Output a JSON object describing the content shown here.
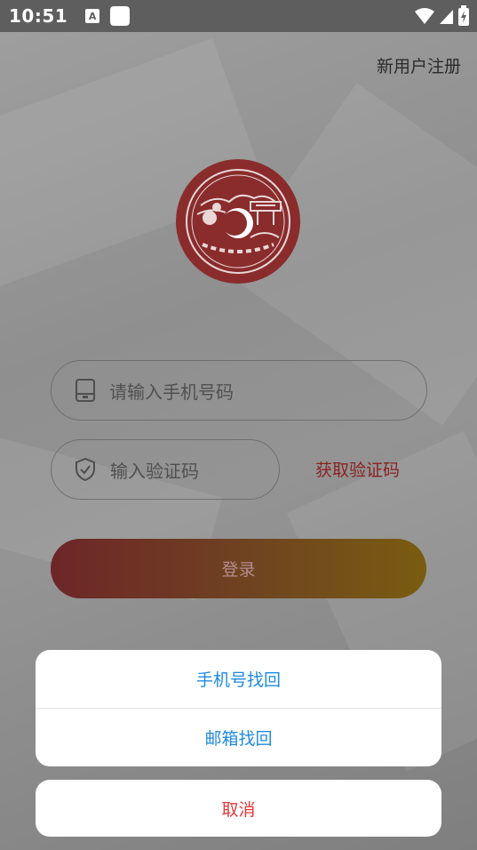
{
  "status_bar": {
    "time": "10:51",
    "notification_icon_letter": "A"
  },
  "header": {
    "register_link": "新用户注册"
  },
  "form": {
    "phone_placeholder": "请输入手机号码",
    "code_placeholder": "输入验证码",
    "get_code_label": "获取验证码",
    "login_button": "登录"
  },
  "action_sheet": {
    "items": [
      {
        "label": "手机号找回"
      },
      {
        "label": "邮箱找回"
      }
    ],
    "cancel_label": "取消"
  },
  "colors": {
    "accent_red": "#8a2222",
    "sheet_blue": "#1f8ae0",
    "cancel_red": "#e8393a"
  }
}
